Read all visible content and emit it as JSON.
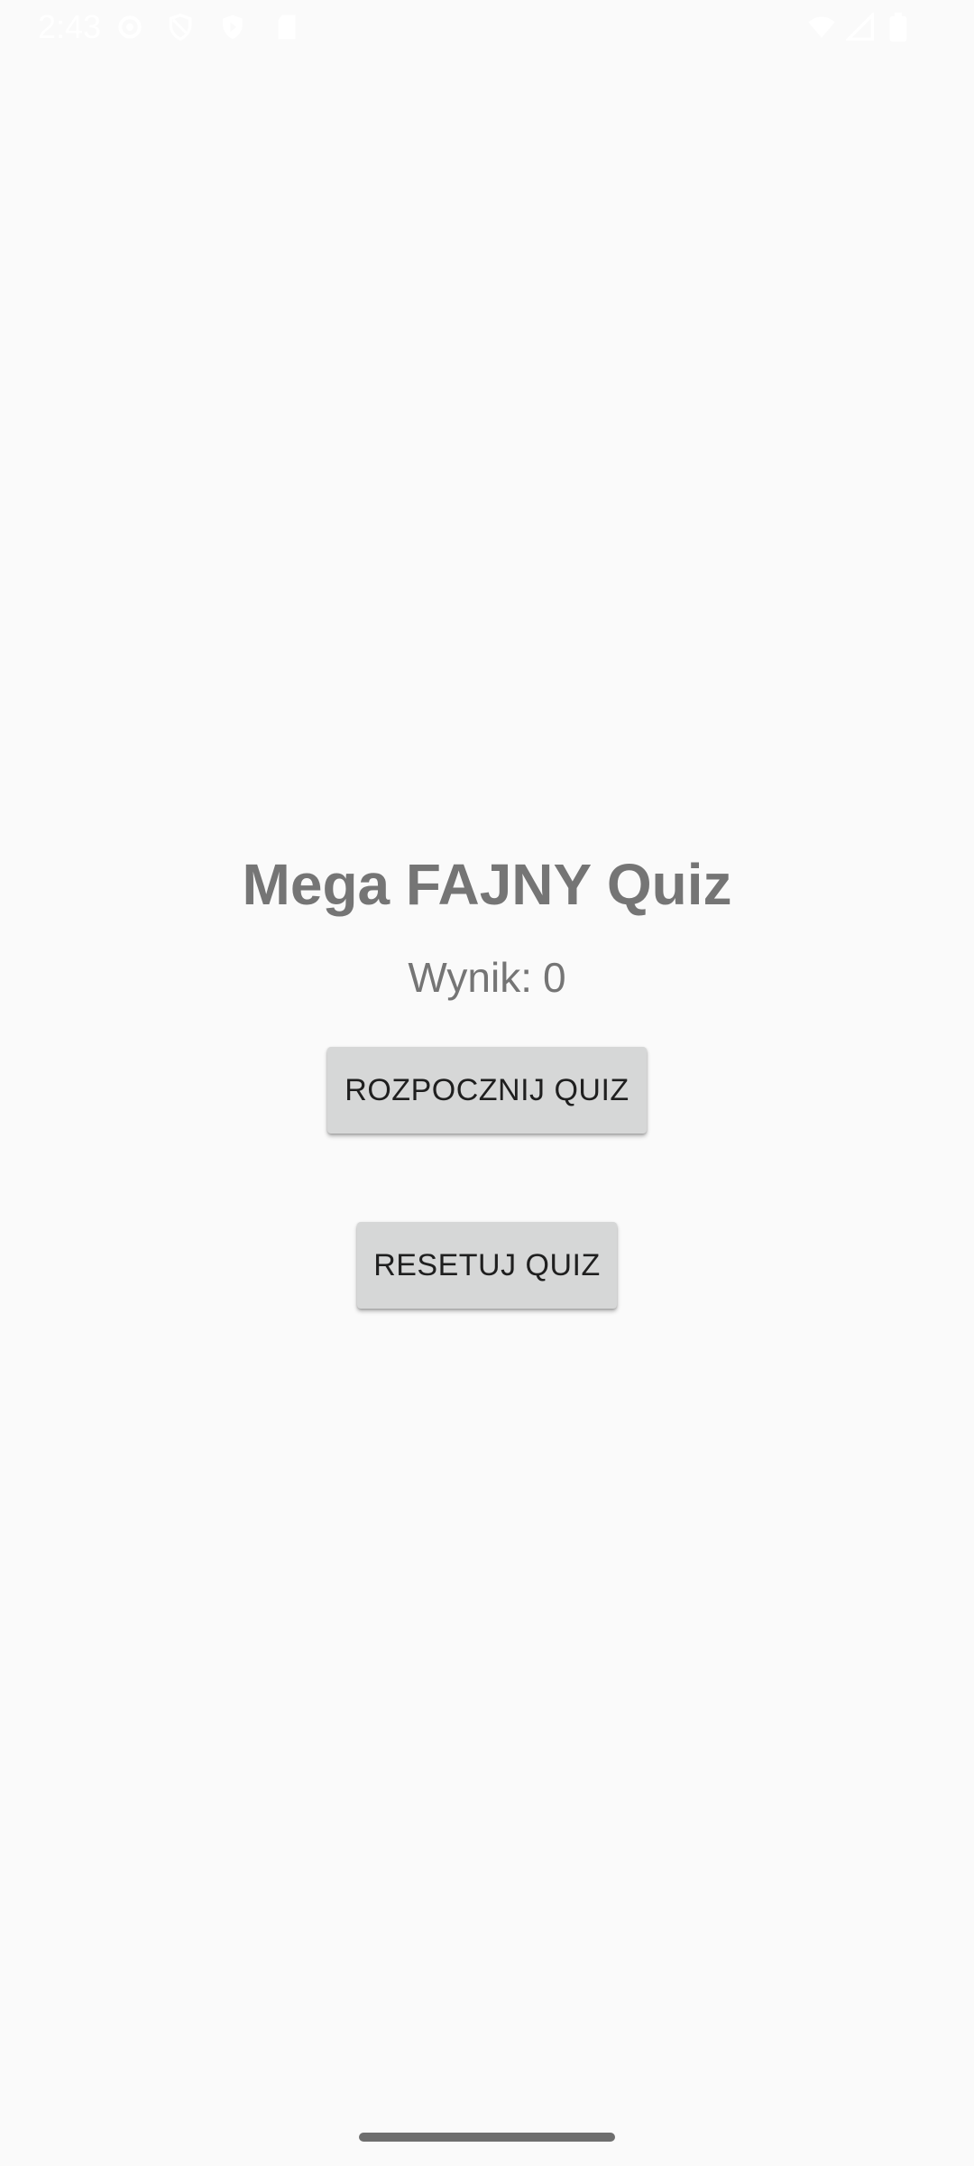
{
  "status_bar": {
    "time": "2:43",
    "left_icons": [
      "settings-icon",
      "vpn-shield-icon",
      "play-protect-icon",
      "sd-card-icon"
    ],
    "right_icons": [
      "wifi-icon",
      "cellular-signal-icon",
      "battery-icon"
    ]
  },
  "app": {
    "title": "Mega FAJNY Quiz",
    "score_label": "Wynik:",
    "score_value": "0",
    "start_button": "ROZPOCZNIJ QUIZ",
    "reset_button": "RESETUJ QUIZ"
  },
  "colors": {
    "background": "#fafafa",
    "text": "#757575",
    "button_bg": "#d6d7d7",
    "button_text": "#1f1f1f"
  }
}
